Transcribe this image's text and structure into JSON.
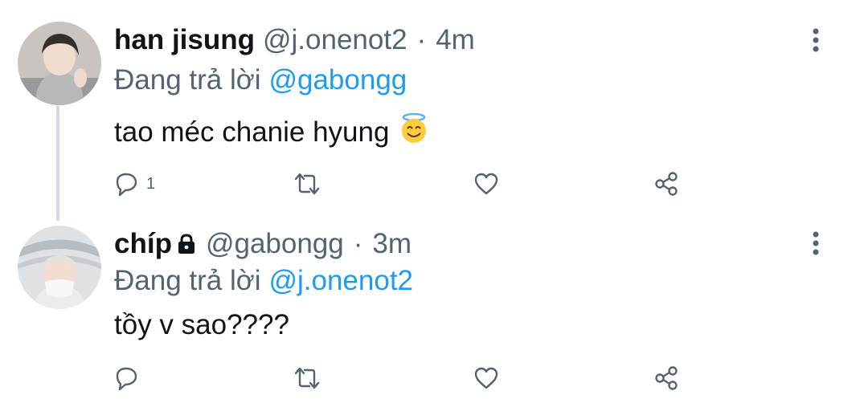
{
  "tweets": [
    {
      "name": "han jisung",
      "handle": "@j.onenot2",
      "separator": "·",
      "time": "4m",
      "replying_prefix": "Đang trả lời",
      "replying_to": "@gabongg",
      "text": "tao méc chanie hyung",
      "emoji": "smiling-face-with-halo",
      "reply_count": "1",
      "protected": false
    },
    {
      "name": "chíp",
      "handle": "@gabongg",
      "separator": "·",
      "time": "3m",
      "replying_prefix": "Đang trả lời",
      "replying_to": "@j.onenot2",
      "text": "tồy v sao????",
      "reply_count": "",
      "protected": true
    }
  ],
  "icons": {
    "reply": "comment-bubble-icon",
    "retweet": "retweet-icon",
    "like": "heart-icon",
    "share": "share-icon",
    "more": "more-vertical-icon",
    "lock": "lock-icon"
  },
  "colors": {
    "text": "#0f1419",
    "secondary": "#536471",
    "accent": "#1d9bf0",
    "thread_line": "#cfd9de"
  }
}
